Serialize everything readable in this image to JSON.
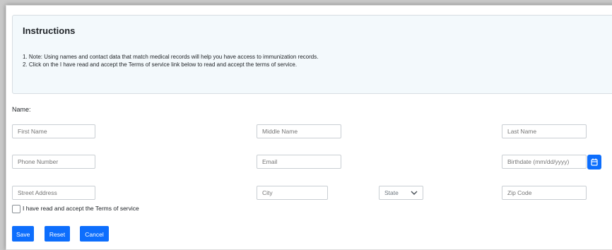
{
  "instructions": {
    "title": "Instructions",
    "items": [
      "1. Note: Using names and contact data that match medical records will help you have access to immunization records.",
      "2. Click on the I have read and accept the Terms of service link below to read and accept the terms of service."
    ]
  },
  "form": {
    "name_label": "Name:",
    "fields": {
      "first_name": {
        "placeholder": "First Name",
        "value": ""
      },
      "middle_name": {
        "placeholder": "Middle Name",
        "value": ""
      },
      "last_name": {
        "placeholder": "Last Name",
        "value": ""
      },
      "phone": {
        "placeholder": "Phone Number",
        "value": ""
      },
      "email": {
        "placeholder": "Email",
        "value": ""
      },
      "birthdate": {
        "placeholder": "Birthdate (mm/dd/yyyy)",
        "value": ""
      },
      "street": {
        "placeholder": "Street Address",
        "value": ""
      },
      "city": {
        "placeholder": "City",
        "value": ""
      },
      "state": {
        "selected": "State"
      },
      "zip": {
        "placeholder": "Zip Code",
        "value": ""
      }
    },
    "terms_label": "I have read and accept the Terms of service",
    "terms_checked": false,
    "buttons": {
      "save": "Save",
      "reset": "Reset",
      "cancel": "Cancel"
    }
  },
  "icons": {
    "calendar": "calendar-icon",
    "state_dropdown": "chevron-down-icon"
  },
  "colors": {
    "primary": "#0d6efd",
    "instructions_bg": "#f3f9fc"
  }
}
